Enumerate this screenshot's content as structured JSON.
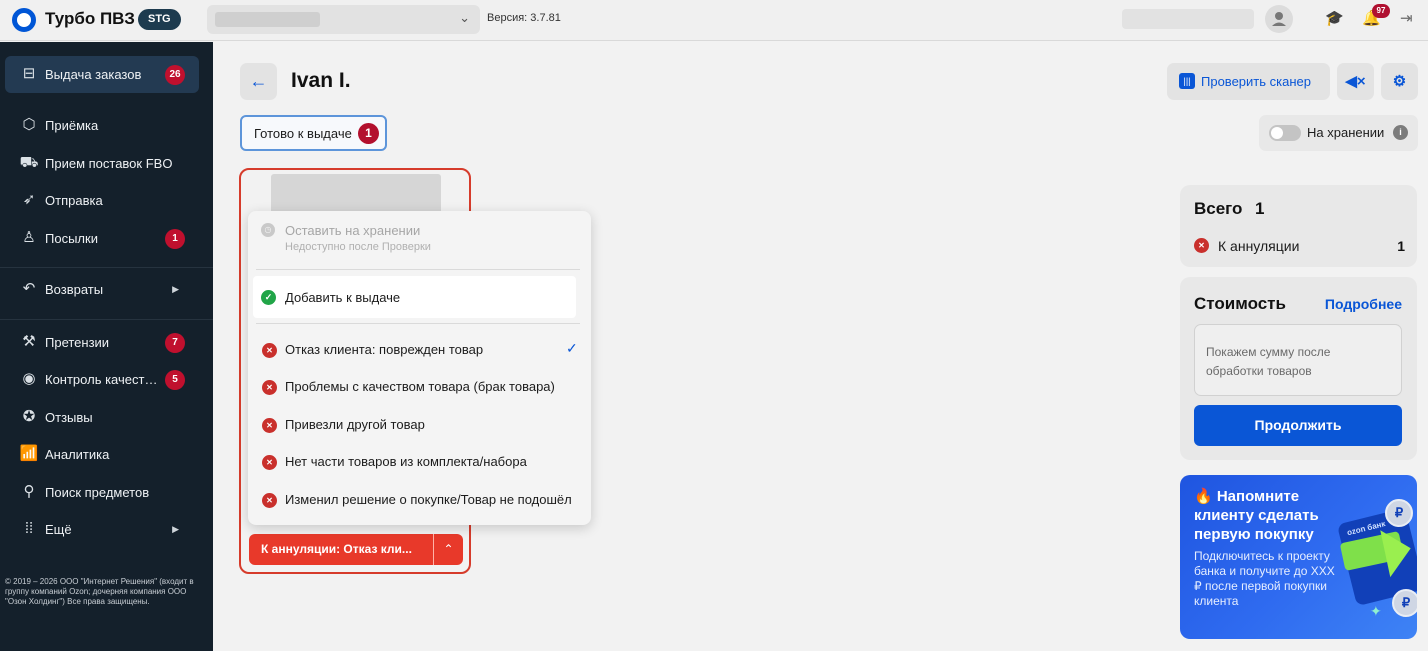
{
  "topbar": {
    "app_title": "Турбо ПВЗ",
    "env_badge": "STG",
    "version": "Версия: 3.7.81",
    "notifications_count": "97"
  },
  "sidebar": {
    "items": [
      {
        "label": "Выдача заказов",
        "badge": "26",
        "icon": "handover-icon"
      },
      {
        "label": "Приёмка",
        "icon": "box-icon"
      },
      {
        "label": "Прием поставок FBO",
        "icon": "truck-icon"
      },
      {
        "label": "Отправка",
        "icon": "send-icon"
      },
      {
        "label": "Посылки",
        "badge": "1",
        "icon": "person-icon"
      },
      {
        "label": "Возвраты",
        "icon": "return-icon"
      },
      {
        "label": "Претензии",
        "badge": "7",
        "icon": "gavel-icon"
      },
      {
        "label": "Контроль качест…",
        "badge": "5",
        "icon": "eye-icon"
      },
      {
        "label": "Отзывы",
        "icon": "review-icon"
      },
      {
        "label": "Аналитика",
        "icon": "analytics-icon"
      },
      {
        "label": "Поиск предметов",
        "icon": "search-icon"
      },
      {
        "label": "Ещё",
        "icon": "grid-icon"
      }
    ],
    "copyright": "© 2019 – 2026 ООО \"Интернет Решения\" (входит в группу компаний Ozon; дочерняя компания ООО \"Озон Холдинг\") Все права защищены."
  },
  "header": {
    "client_name": "Ivan I.",
    "check_scanner": "Проверить сканер"
  },
  "tabs": {
    "ready": {
      "label": "Готово к выдаче",
      "count": "1"
    }
  },
  "storage_toggle": {
    "label": "На хранении",
    "on": false
  },
  "dropdown": {
    "disabled_option": {
      "title": "Оставить на хранении",
      "subtitle": "Недоступно после Проверки"
    },
    "add_option": "Добавить к выдаче",
    "reasons": [
      {
        "label": "Отказ клиента: поврежден товар",
        "selected": true
      },
      {
        "label": "Проблемы с качеством товара (брак товара)",
        "selected": false
      },
      {
        "label": "Привезли другой товар",
        "selected": false
      },
      {
        "label": "Нет части товаров из комплекта/набора",
        "selected": false
      },
      {
        "label": "Изменил решение о покупке/Товар не подошёл",
        "selected": false
      }
    ]
  },
  "item": {
    "action_button": "К аннуляции: Отказ кли..."
  },
  "summary": {
    "total_label": "Всего",
    "total_value": "1",
    "cancel_label": "К аннуляции",
    "cancel_count": "1"
  },
  "cost": {
    "label": "Стоимость",
    "more_link": "Подробнее",
    "hint": "Покажем сумму после обработки товаров",
    "continue_button": "Продолжить"
  },
  "promo": {
    "title": "🔥 Напомните клиенту сделать первую покупку",
    "text": "Подключитесь к проекту банка и получите до XXX ₽ после первой покупки клиента",
    "card_text": "ozon банк",
    "coin_symbol": "₽"
  },
  "colors": {
    "accent": "#0a56d6",
    "danger": "#e8392a",
    "success": "#21a548",
    "sidebar_bg": "#14202b"
  }
}
